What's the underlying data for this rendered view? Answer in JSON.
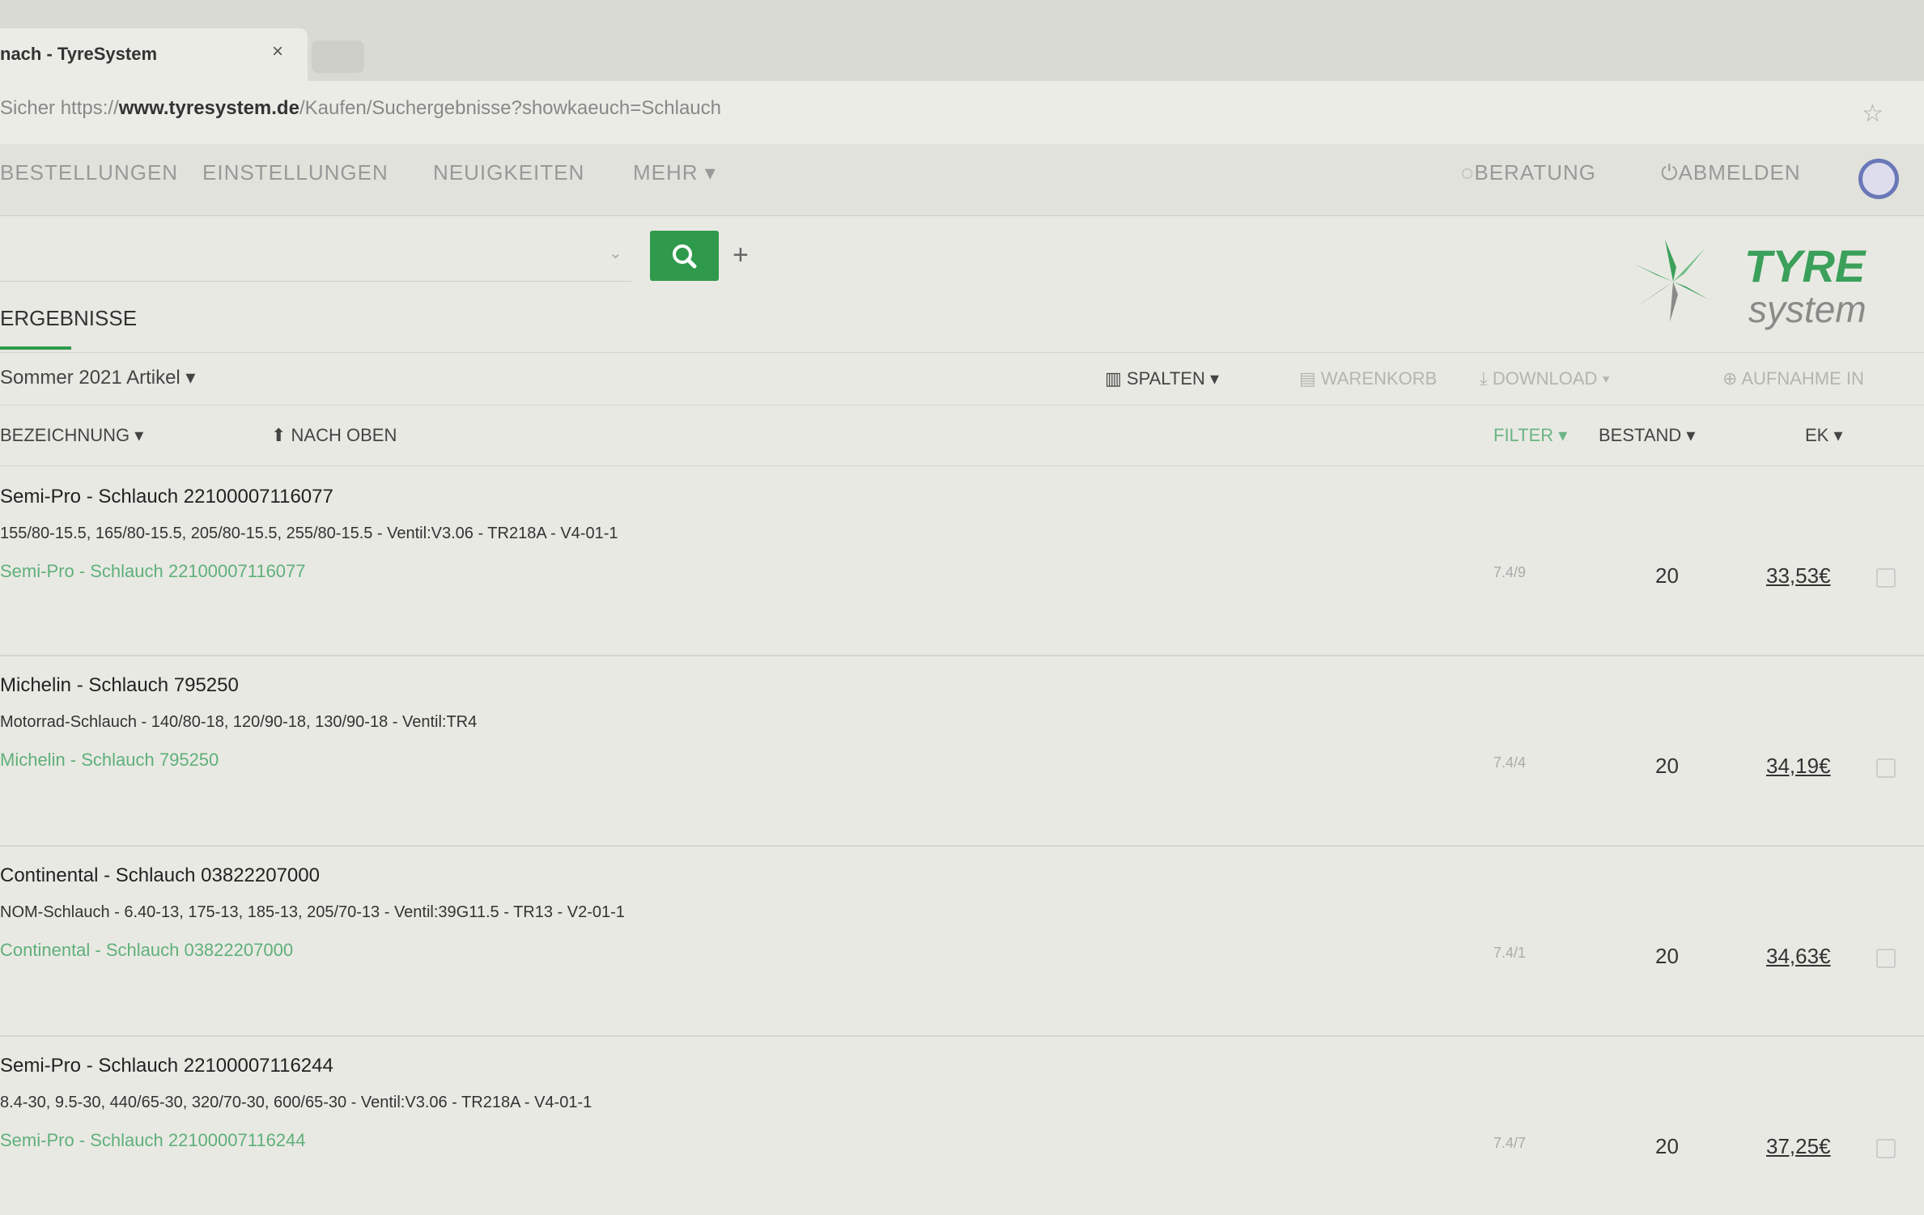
{
  "browser": {
    "tab_title": "nach - TyreSystem",
    "tab_close": "×",
    "url_prefix": "Sicher  https://",
    "url_domain": "www.tyresystem.de",
    "url_path": "/Kaufen/Suchergebnisse?showkaeuch=Schlauch"
  },
  "nav": {
    "items": [
      "BESTELLUNGEN",
      "EINSTELLUNGEN",
      "NEUIGKEITEN",
      "MEHR ▾"
    ],
    "right": [
      "BERATUNG",
      "ABMELDEN"
    ]
  },
  "search": {
    "value": "",
    "dropdown_caret": "⌄",
    "plus": "+"
  },
  "logo": {
    "line1": "TYRE",
    "line2": "system"
  },
  "results": {
    "tab_label": "ERGEBNISSE",
    "season": "Sommer 2021 Artikel ▾",
    "tools": [
      "SPALTEN ▾",
      "WARENKORB",
      "DOWNLOAD ▾",
      "AUFNAHME IN"
    ]
  },
  "columns": {
    "name": "BEZEICHNUNG ▾",
    "sort": "NACH OBEN",
    "filter": "FILTER ▾",
    "stock": "BESTAND ▾",
    "price": "EK ▾"
  },
  "rows": [
    {
      "title": "Semi-Pro - Schlauch 22100007116077",
      "desc": "155/80-15.5, 165/80-15.5, 205/80-15.5, 255/80-15.5 - Ventil:V3.06 - TR218A - V4-01-1",
      "link": "Semi-Pro - Schlauch 22100007116077",
      "filter": "7.4/9",
      "stock": "20",
      "price": "33,53€"
    },
    {
      "title": "Michelin - Schlauch 795250",
      "desc": "Motorrad-Schlauch - 140/80-18, 120/90-18, 130/90-18 - Ventil:TR4",
      "link": "Michelin - Schlauch 795250",
      "filter": "7.4/4",
      "stock": "20",
      "price": "34,19€"
    },
    {
      "title": "Continental - Schlauch 03822207000",
      "desc": "NOM-Schlauch - 6.40-13, 175-13, 185-13, 205/70-13 - Ventil:39G11.5 - TR13 - V2-01-1",
      "link": "Continental - Schlauch 03822207000",
      "filter": "7.4/1",
      "stock": "20",
      "price": "34,63€"
    },
    {
      "title": "Semi-Pro - Schlauch 22100007116244",
      "desc": "8.4-30, 9.5-30, 440/65-30, 320/70-30, 600/65-30 - Ventil:V3.06 - TR218A - V4-01-1",
      "link": "Semi-Pro - Schlauch 22100007116244",
      "filter": "7.4/7",
      "stock": "20",
      "price": "37,25€"
    }
  ],
  "colors": {
    "accent": "#2f9a4c",
    "link": "#5fb07b",
    "logo_green": "#3aa05a",
    "logo_grey": "#8a8a88"
  }
}
